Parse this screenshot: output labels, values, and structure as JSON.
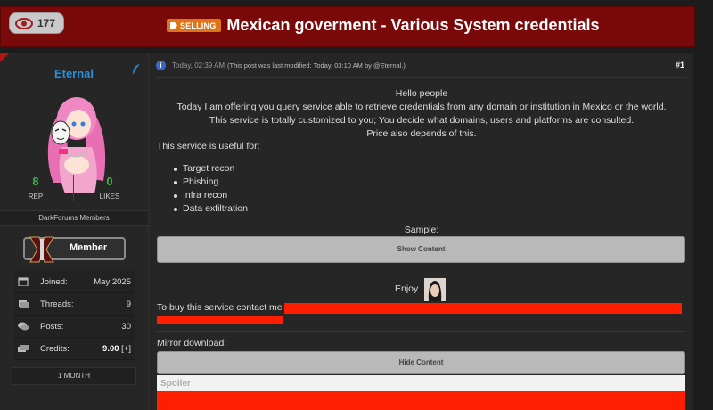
{
  "header": {
    "view_count": "177",
    "prefix_label": "SELLING",
    "thread_title": "Mexican goverment - Various System credentials",
    "colors": {
      "bar": "#7a0a0a",
      "prefix": "#e07418"
    }
  },
  "author": {
    "username": "Eternal",
    "rep_value": "8",
    "rep_label": "REP",
    "likes_value": "0",
    "likes_label": "LIKES",
    "group": "DarkForums Members",
    "rank": "Member",
    "info": [
      {
        "key": "Joined:",
        "value": "May 2025",
        "icon": "calendar-icon"
      },
      {
        "key": "Threads:",
        "value": "9",
        "icon": "threads-icon"
      },
      {
        "key": "Posts:",
        "value": "30",
        "icon": "posts-icon"
      },
      {
        "key": "Credits:",
        "value": "9.00",
        "extra": "[+]",
        "icon": "credits-icon"
      }
    ],
    "tenure": "1 MONTH"
  },
  "post": {
    "date": "Today, 02:39 AM",
    "modified_note": "(This post was last modified: Today, 03:10 AM by @Eternal.)",
    "number": "#1",
    "lines_center": [
      "Hello people",
      "Today I am offering you query service able to retrieve credentials from any domain or institution in Mexico or the world.",
      "This service is totally customized to you; You decide what domains, users and platforms are consulted.",
      "Price also depends of this."
    ],
    "useful_heading": "This service is useful for:",
    "useful_items": [
      "Target recon",
      "Phishing",
      "Infra recon",
      "Data exfiltration"
    ],
    "sample_label": "Sample:",
    "show_content_label": "Show Content",
    "enjoy_label": "Enjoy",
    "contact_text": "To buy this service contact me",
    "mirror_label": "Mirror download:",
    "hide_content_label": "Hide Content",
    "spoiler_label": "Spoiler"
  }
}
